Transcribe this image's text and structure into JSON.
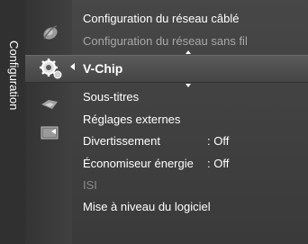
{
  "side_tab": {
    "label": "Configuration"
  },
  "menu": {
    "items": [
      {
        "label": "Configuration du réseau câblé"
      },
      {
        "label": "Configuration du réseau sans fil"
      },
      {
        "label": "V-Chip"
      },
      {
        "label": "Sous-titres"
      },
      {
        "label": "Réglages externes"
      },
      {
        "label": "Divertissement",
        "value": ": Off"
      },
      {
        "label": "Économiseur énergie",
        "value": ": Off"
      },
      {
        "label": "ISI"
      },
      {
        "label": "Mise à niveau du logiciel"
      }
    ]
  },
  "icons": [
    "globe-icon",
    "settings-gear-icon",
    "speaker-icon",
    "input-icon"
  ]
}
